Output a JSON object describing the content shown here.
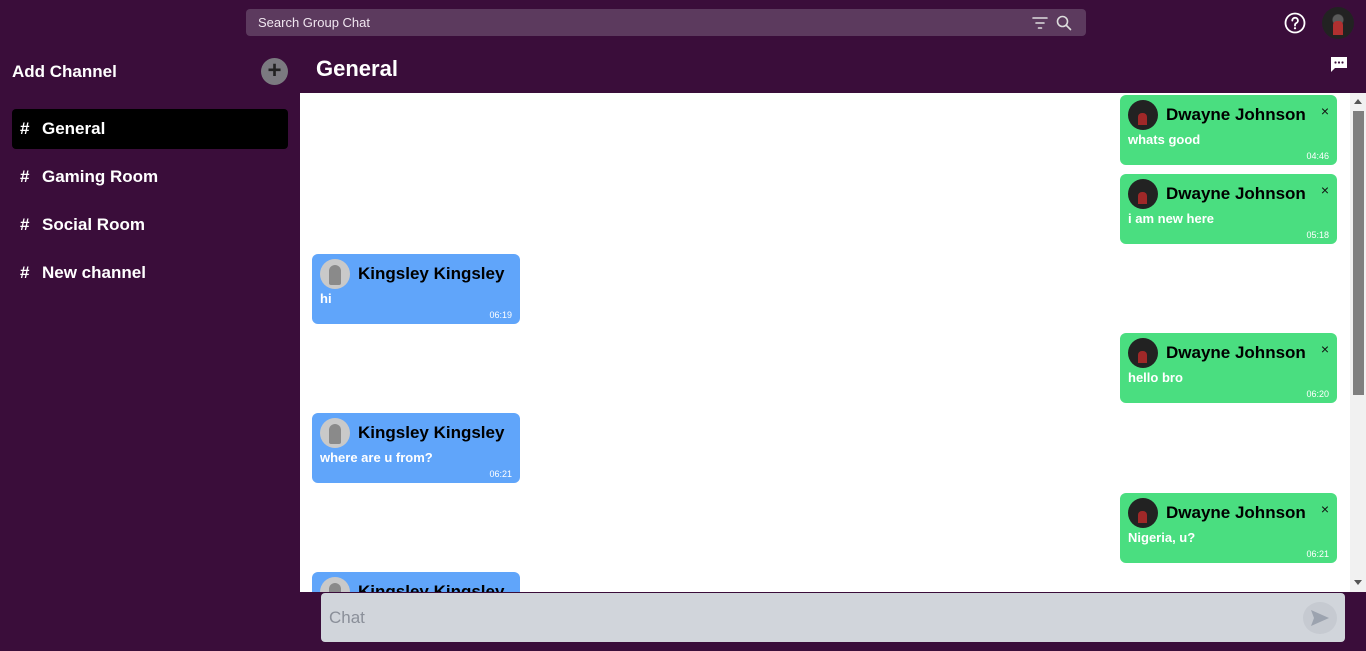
{
  "search": {
    "placeholder": "Search Group Chat"
  },
  "sidebar": {
    "add_channel_label": "Add Channel",
    "add_icon": "+",
    "channels": [
      {
        "hash": "#",
        "label": "General",
        "active": true
      },
      {
        "hash": "#",
        "label": "Gaming Room",
        "active": false
      },
      {
        "hash": "#",
        "label": "Social Room",
        "active": false
      },
      {
        "hash": "#",
        "label": "New channel",
        "active": false
      }
    ]
  },
  "main": {
    "title": "General"
  },
  "messages": [
    {
      "author": "Dwayne Johnson",
      "text": "whats good",
      "time": "04:46",
      "mine": true,
      "close": "×"
    },
    {
      "author": "Dwayne Johnson",
      "text": "i am new here",
      "time": "05:18",
      "mine": true,
      "close": "×"
    },
    {
      "author": "Kingsley Kingsley",
      "text": "hi",
      "time": "06:19",
      "mine": false
    },
    {
      "author": "Dwayne Johnson",
      "text": "hello bro",
      "time": "06:20",
      "mine": true,
      "close": "×"
    },
    {
      "author": "Kingsley Kingsley",
      "text": "where are u from?",
      "time": "06:21",
      "mine": false
    },
    {
      "author": "Dwayne Johnson",
      "text": "Nigeria, u?",
      "time": "06:21",
      "mine": true,
      "close": "×"
    },
    {
      "author": "Kingsley Kingsley",
      "text": "",
      "time": "",
      "mine": false
    }
  ],
  "composer": {
    "placeholder": "Chat"
  },
  "colors": {
    "sidebar": "#3a0d3a",
    "mine_bubble": "#4ade80",
    "theirs_bubble": "#60a5fa",
    "active_channel": "#000000"
  },
  "icons": {
    "filter": "filter-icon",
    "search": "search-icon",
    "help": "help-icon",
    "chat": "chat-bubble-icon",
    "send": "send-icon"
  }
}
